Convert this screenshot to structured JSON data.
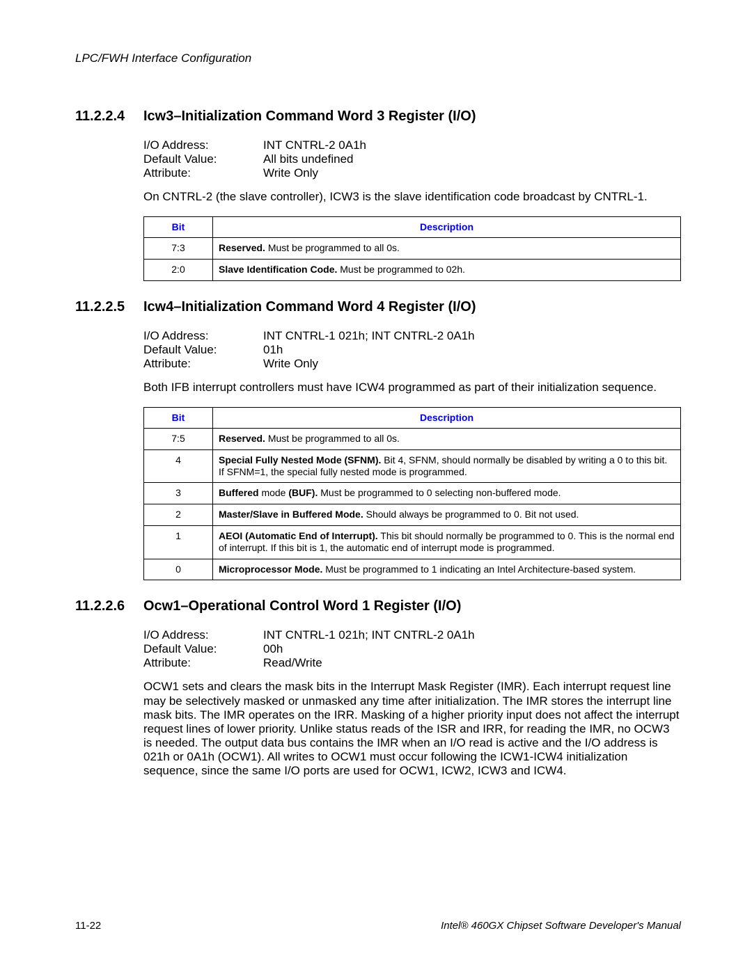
{
  "header": {
    "running_head": "LPC/FWH Interface Configuration"
  },
  "sections": {
    "s1": {
      "num": "11.2.2.4",
      "title": "Icw3–Initialization Command Word 3 Register (I/O)",
      "attrs": {
        "io_label": "I/O Address:",
        "io_value": "INT CNTRL-2 0A1h",
        "def_label": "Default Value:",
        "def_value": "All bits undefined",
        "attr_label": "Attribute:",
        "attr_value": "Write Only"
      },
      "para": "On CNTRL-2 (the slave controller), ICW3 is the slave identification code broadcast by CNTRL-1.",
      "table": {
        "head_bit": "Bit",
        "head_desc": "Description",
        "rows": [
          {
            "bit": "7:3",
            "bold": "Reserved.",
            "rest": " Must be programmed to all 0s."
          },
          {
            "bit": "2:0",
            "bold": "Slave Identification Code.",
            "rest": " Must be programmed to 02h."
          }
        ]
      }
    },
    "s2": {
      "num": "11.2.2.5",
      "title": "Icw4–Initialization Command Word 4 Register (I/O)",
      "attrs": {
        "io_label": "I/O Address:",
        "io_value": "INT CNTRL-1 021h; INT CNTRL-2 0A1h",
        "def_label": "Default Value:",
        "def_value": "01h",
        "attr_label": "Attribute:",
        "attr_value": "Write Only"
      },
      "para": "Both IFB interrupt controllers must have ICW4 programmed as part of their initialization sequence.",
      "table": {
        "head_bit": "Bit",
        "head_desc": "Description",
        "rows": [
          {
            "bit": "7:5",
            "bold": "Reserved.",
            "rest": " Must be programmed to all 0s."
          },
          {
            "bit": "4",
            "bold": "Special Fully Nested Mode (SFNM).",
            "rest": " Bit 4, SFNM, should normally be disabled by writing a 0 to this bit. If SFNM=1, the special fully nested mode is programmed."
          },
          {
            "bit": "3",
            "bold": "Buffered",
            "rest": " mode ",
            "bold2": "(BUF).",
            "rest2": " Must be programmed to 0 selecting non-buffered mode."
          },
          {
            "bit": "2",
            "bold": "Master/Slave in Buffered Mode.",
            "rest": " Should always be programmed to 0. Bit not used."
          },
          {
            "bit": "1",
            "bold": "AEOI (Automatic End of Interrupt).",
            "rest": " This bit should normally be programmed to 0. This is the normal end of interrupt. If this bit is 1, the automatic end of interrupt mode is programmed."
          },
          {
            "bit": "0",
            "bold": "Microprocessor Mode.",
            "rest": " Must be programmed to 1 indicating an Intel Architecture-based system."
          }
        ]
      }
    },
    "s3": {
      "num": "11.2.2.6",
      "title": "Ocw1–Operational Control Word 1 Register (I/O)",
      "attrs": {
        "io_label": "I/O Address:",
        "io_value": "INT CNTRL-1 021h; INT CNTRL-2 0A1h",
        "def_label": "Default Value:",
        "def_value": "00h",
        "attr_label": "Attribute:",
        "attr_value": "Read/Write"
      },
      "para": "OCW1 sets and clears the mask bits in the Interrupt Mask Register (IMR). Each interrupt request line may be selectively masked or unmasked any time after initialization. The IMR stores the interrupt line mask bits. The IMR operates on the IRR. Masking of a higher priority input does not affect the interrupt request lines of lower priority. Unlike status reads of the ISR and IRR, for reading the IMR, no OCW3 is needed. The output data bus contains the IMR when an I/O read is active and the I/O address is 021h or 0A1h (OCW1). All writes to OCW1 must occur following the ICW1-ICW4 initialization sequence, since the same I/O ports are used for OCW1, ICW2, ICW3 and ICW4."
    }
  },
  "footer": {
    "left": "11-22",
    "right": "Intel® 460GX Chipset Software Developer's Manual"
  }
}
